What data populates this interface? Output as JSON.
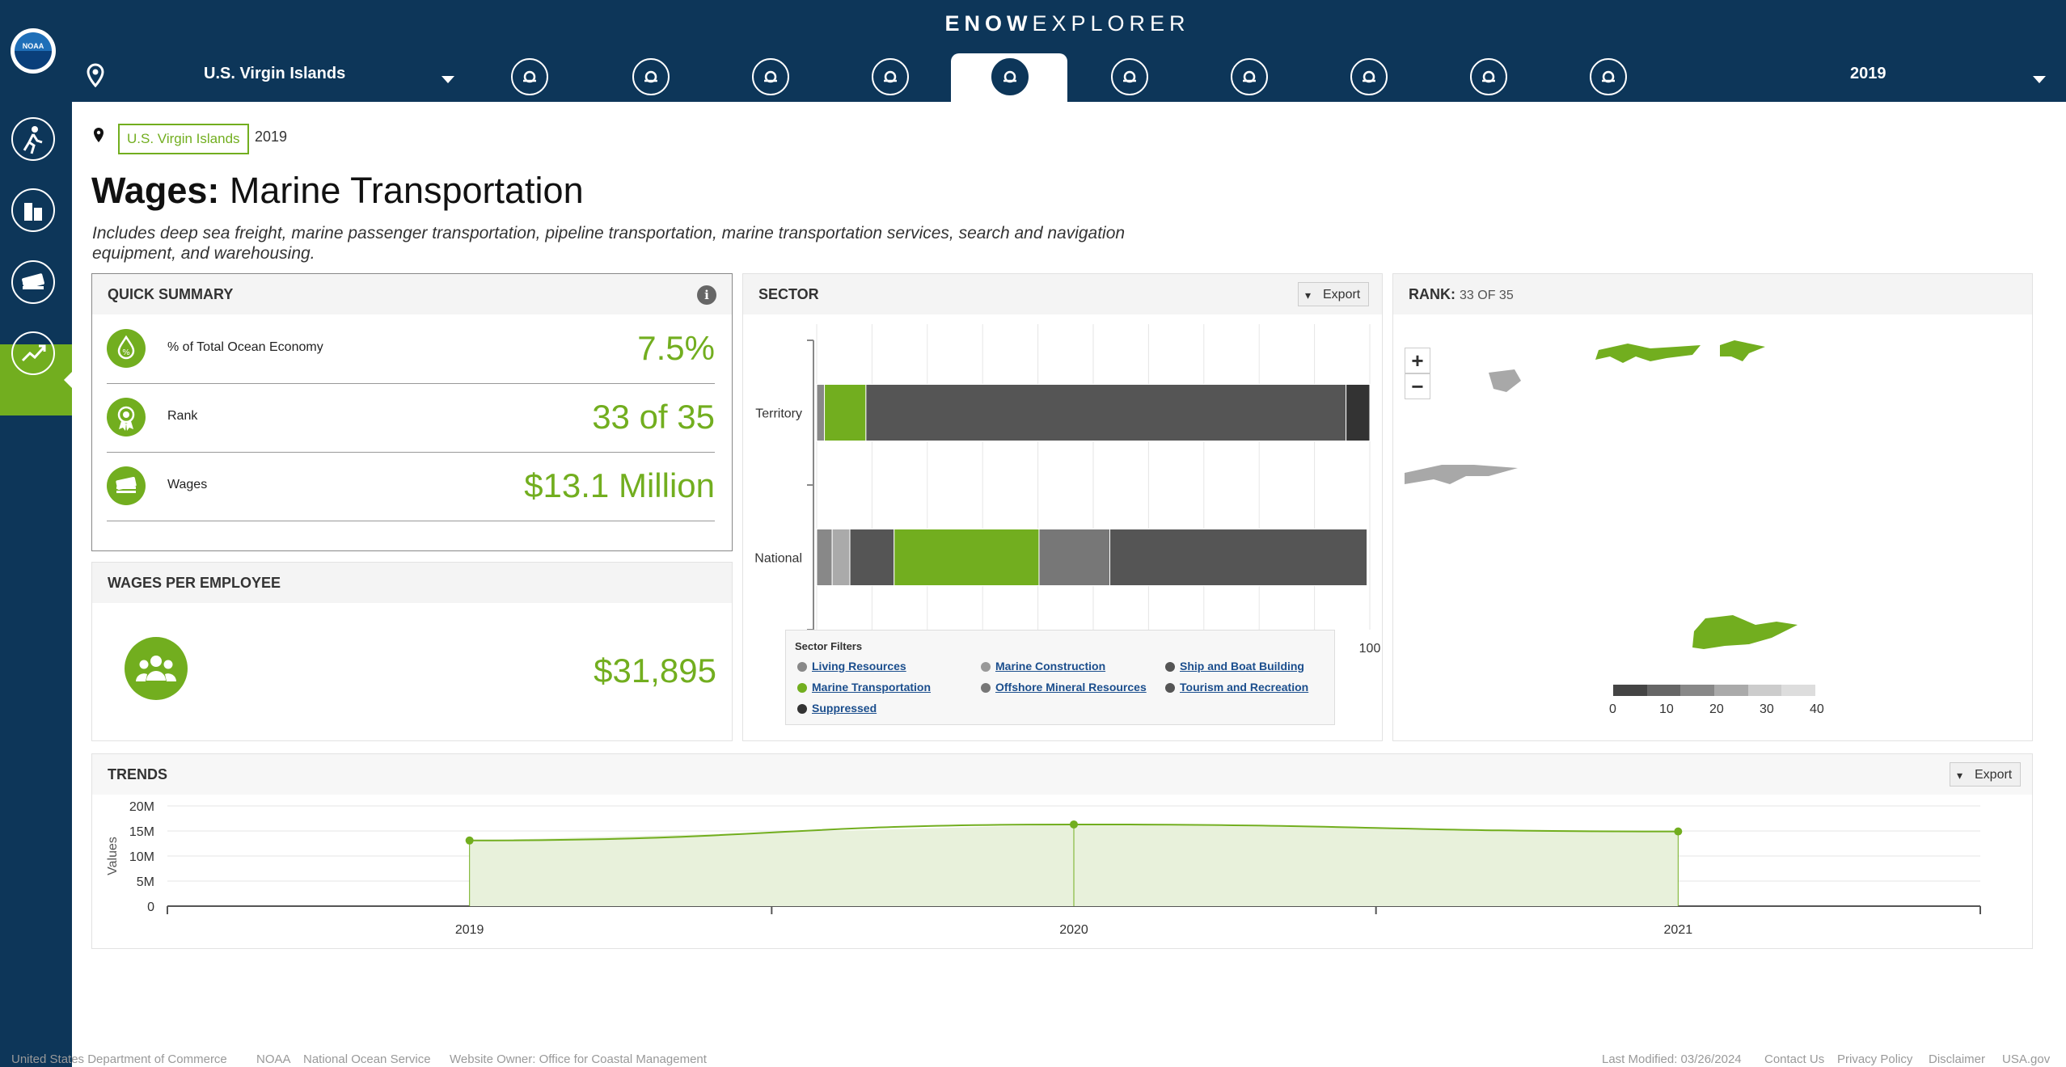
{
  "header": {
    "brand_bold": "ENOW",
    "brand_light": "EXPLORER",
    "location": "U.S. Virgin Islands",
    "year": "2019",
    "sector_icons": [
      "wave-icon",
      "fish-icon",
      "anchor-icon",
      "bell-icon",
      "ship-icon",
      "offshore-rig-icon",
      "sailboat-icon",
      "lighthouse-icon",
      "graduation-cap-icon",
      "capitol-icon"
    ]
  },
  "sidenav": {
    "items": [
      "hiker-icon",
      "buildings-icon",
      "money-icon",
      "trend-icon"
    ],
    "active_index": 2
  },
  "breadcrumb": {
    "location": "U.S. Virgin Islands",
    "year": "2019"
  },
  "page": {
    "title_bold": "Wages:",
    "title_rest": "Marine Transportation",
    "description": "Includes deep sea freight, marine passenger transportation, pipeline transportation, marine transportation services, search and navigation equipment, and warehousing."
  },
  "quick_summary": {
    "title": "QUICK SUMMARY",
    "rows": [
      {
        "label": "% of Total Ocean Economy",
        "value": "7.5%"
      },
      {
        "label": "Rank",
        "value": "33 of 35"
      },
      {
        "label": "Wages",
        "value": "$13.1 Million"
      }
    ]
  },
  "wages_per_employee": {
    "title": "WAGES PER EMPLOYEE",
    "value": "$31,895"
  },
  "sector": {
    "title": "SECTOR",
    "export_label": "Export",
    "legend_title": "Sector Filters",
    "legend": [
      {
        "label": "Living Resources",
        "color": "#888888"
      },
      {
        "label": "Marine Construction",
        "color": "#999999"
      },
      {
        "label": "Ship and Boat Building",
        "color": "#555555"
      },
      {
        "label": "Marine Transportation",
        "color": "#72ae1f"
      },
      {
        "label": "Offshore Mineral Resources",
        "color": "#777777"
      },
      {
        "label": "Tourism and Recreation",
        "color": "#555555"
      },
      {
        "label": "Suppressed",
        "color": "#333333"
      }
    ]
  },
  "rank": {
    "title": "RANK:",
    "value": "33 OF 35",
    "scale_labels": [
      "0",
      "10",
      "20",
      "30",
      "40"
    ]
  },
  "trends": {
    "title": "TRENDS",
    "export_label": "Export"
  },
  "chart_data": [
    {
      "type": "bar",
      "orientation": "horizontal",
      "stacked": true,
      "categories": [
        "Territory",
        "National"
      ],
      "xlim": [
        0,
        100
      ],
      "xticks": [
        0,
        10,
        20,
        30,
        40,
        50,
        60,
        70,
        80,
        90,
        100
      ],
      "series": [
        {
          "name": "Living Resources",
          "color": "#888888",
          "values": [
            1.4,
            2.8
          ]
        },
        {
          "name": "Marine Construction",
          "color": "#aaaaaa",
          "values": [
            0,
            3.2
          ]
        },
        {
          "name": "Ship and Boat Building",
          "color": "#555555",
          "values": [
            0,
            8.0
          ]
        },
        {
          "name": "Marine Transportation",
          "color": "#72ae1f",
          "values": [
            7.5,
            26.2
          ]
        },
        {
          "name": "Offshore Mineral Resources",
          "color": "#777777",
          "values": [
            0,
            12.8
          ]
        },
        {
          "name": "Tourism and Recreation",
          "color": "#555555",
          "values": [
            86.8,
            46.5
          ]
        },
        {
          "name": "Suppressed",
          "color": "#333333",
          "values": [
            4.3,
            0
          ]
        }
      ],
      "grid": true
    },
    {
      "type": "area",
      "x": [
        "2019",
        "2020",
        "2021"
      ],
      "values": [
        13100000,
        16300000,
        14900000
      ],
      "ylabel": "Values",
      "yticks": [
        "0",
        "5M",
        "10M",
        "15M",
        "20M"
      ],
      "ylim": [
        0,
        20000000
      ],
      "color": "#72ae1f"
    }
  ],
  "footer": {
    "left": [
      "United States Department of Commerce",
      "NOAA",
      "National Ocean Service",
      "Website Owner: Office for Coastal Management"
    ],
    "right": [
      "Last Modified: 03/26/2024",
      "Contact Us",
      "Privacy Policy",
      "Disclaimer",
      "USA.gov"
    ]
  }
}
